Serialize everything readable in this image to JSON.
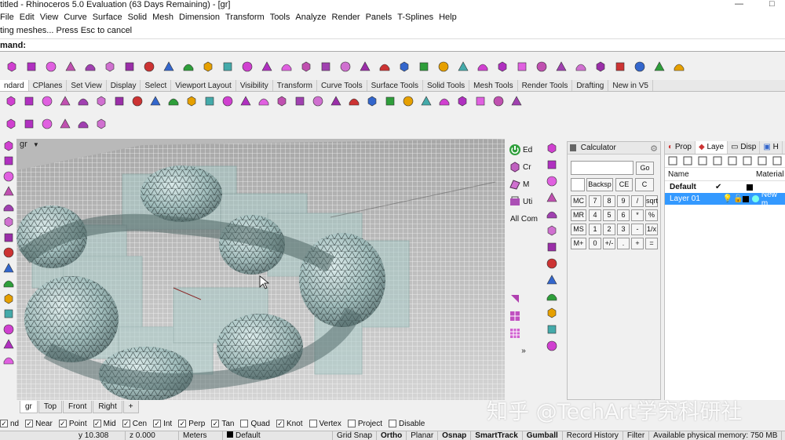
{
  "window": {
    "title": "titled - Rhinoceros 5.0 Evaluation (63 Days Remaining) - [gr]",
    "controls": [
      "—",
      "□"
    ]
  },
  "menu": [
    "File",
    "Edit",
    "View",
    "Curve",
    "Surface",
    "Solid",
    "Mesh",
    "Dimension",
    "Transform",
    "Tools",
    "Analyze",
    "Render",
    "Panels",
    "T-Splines",
    "Help"
  ],
  "command": {
    "history": "ting meshes... Press Esc to cancel",
    "prompt": "mand:"
  },
  "toolbar_tabs": [
    "ndard",
    "CPlanes",
    "Set View",
    "Display",
    "Select",
    "Viewport Layout",
    "Visibility",
    "Transform",
    "Curve Tools",
    "Surface Tools",
    "Solid Tools",
    "Mesh Tools",
    "Render Tools",
    "Drafting",
    "New in V5"
  ],
  "viewport": {
    "name": "gr",
    "tabs": [
      "gr",
      "Top",
      "Front",
      "Right"
    ],
    "add_tab": "+"
  },
  "side_toolbar": {
    "items": [
      "Ed",
      "Cr",
      "M",
      "Uti",
      "All Com"
    ],
    "more": "»"
  },
  "calculator": {
    "title": "Calculator",
    "go": "Go",
    "backsp": "Backsp",
    "ce": "CE",
    "c": "C",
    "rows": [
      [
        "MC",
        "7",
        "8",
        "9",
        "/",
        "sqrt"
      ],
      [
        "MR",
        "4",
        "5",
        "6",
        "*",
        "%"
      ],
      [
        "MS",
        "1",
        "2",
        "3",
        "-",
        "1/x"
      ],
      [
        "M+",
        "0",
        "+/-",
        ".",
        "+",
        "="
      ]
    ]
  },
  "panel": {
    "tabs": [
      "Prop",
      "Laye",
      "Disp",
      "H"
    ],
    "columns": [
      "Name",
      "Material"
    ],
    "layers": [
      {
        "name": "Default",
        "current": "✔",
        "material": ""
      },
      {
        "name": "Layer 01",
        "current": "",
        "material": "New m"
      }
    ]
  },
  "osnap": [
    {
      "label": "nd",
      "checked": true
    },
    {
      "label": "Near",
      "checked": true
    },
    {
      "label": "Point",
      "checked": true
    },
    {
      "label": "Mid",
      "checked": true
    },
    {
      "label": "Cen",
      "checked": true
    },
    {
      "label": "Int",
      "checked": true
    },
    {
      "label": "Perp",
      "checked": true
    },
    {
      "label": "Tan",
      "checked": true
    },
    {
      "label": "Quad",
      "checked": false
    },
    {
      "label": "Knot",
      "checked": true
    },
    {
      "label": "Vertex",
      "checked": false
    },
    {
      "label": "Project",
      "checked": false
    },
    {
      "label": "Disable",
      "checked": false
    }
  ],
  "status": {
    "y": "y 10.308",
    "z": "z 0.000",
    "units": "Meters",
    "layer": "Default",
    "grid_snap": "Grid Snap",
    "ortho": "Ortho",
    "planar": "Planar",
    "osnap": "Osnap",
    "smarttrack": "SmartTrack",
    "gumball": "Gumball",
    "record_history": "Record History",
    "filter": "Filter",
    "memory": "Available physical memory: 750 MB"
  },
  "watermark": "知乎 @TechArt学究科研社",
  "colors": {
    "accent": "#3399ff",
    "viewport_bg": "#c8c8c8",
    "mesh_color": "#9fc4c0"
  },
  "icons": {
    "top_row": [
      "box-icon",
      "cylinder-icon",
      "sphere-icon",
      "cone-icon",
      "cube-icon",
      "pipe-icon",
      "loft-icon",
      "sweep-icon",
      "revolve-icon",
      "extrude-icon",
      "fillet-icon",
      "boolean-icon",
      "shell-icon",
      "mesh-icon",
      "cage-icon",
      "bend-icon",
      "twist-icon",
      "taper-icon",
      "flow-icon",
      "splop-icon",
      "morph-icon",
      "array-icon",
      "mirror-icon",
      "scale-icon",
      "rotate-icon",
      "move-icon",
      "copy-icon",
      "join-icon",
      "explode-icon",
      "trim-icon",
      "split-icon",
      "group-icon",
      "ungroup-icon",
      "layer-icon",
      "render-icon"
    ],
    "second_row": [
      "new-icon",
      "save-icon",
      "print-icon",
      "cut-icon",
      "copy-icon",
      "paste-icon",
      "undo-icon",
      "pan-icon",
      "rotate-view-icon",
      "zoom-icon",
      "zoom-window-icon",
      "zoom-extents-icon",
      "zoom-selected-icon",
      "undo-view-icon",
      "four-views-icon",
      "car-icon",
      "grid-icon",
      "osnap-icon",
      "gumball-icon",
      "light-icon",
      "material-icon",
      "color-icon",
      "render-preview-icon",
      "sphere-render-icon",
      "render-icon",
      "select-icon",
      "filter-icon",
      "history-icon",
      "help-icon"
    ],
    "third_row": [
      "shade-icon",
      "wire-icon",
      "render-mesh-icon",
      "xray-icon",
      "ghost-icon",
      "technical-icon"
    ],
    "left_col": [
      "pointer-icon",
      "select-window-icon",
      "line-icon",
      "polyline-icon",
      "curve-icon",
      "circle-icon",
      "arc-icon",
      "rectangle-icon",
      "polygon-icon",
      "text-icon",
      "dimension-icon",
      "surface-icon",
      "solid-icon",
      "mesh-icon",
      "transform-icon"
    ],
    "right_col": [
      "power-icon",
      "cube-edit-icon",
      "mesh-tool-icon",
      "utility-icon",
      "grid-icon",
      "cage-icon",
      "align-icon",
      "layer-icon",
      "color-icon",
      "sphere-icon",
      "gradient-icon",
      "wire-cube-icon",
      "points-icon"
    ]
  }
}
